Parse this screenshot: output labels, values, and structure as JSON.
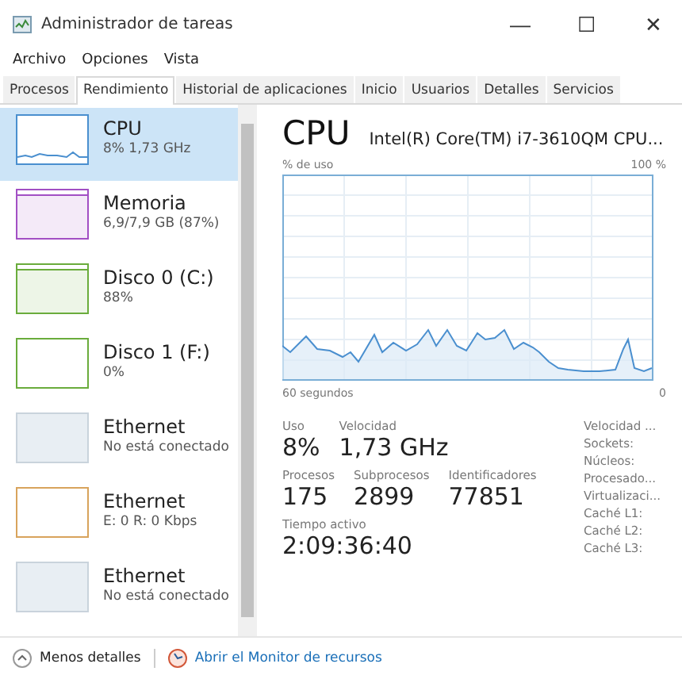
{
  "window": {
    "title": "Administrador de tareas",
    "controls": [
      "—",
      "☐",
      "✕"
    ]
  },
  "menu": [
    "Archivo",
    "Opciones",
    "Vista"
  ],
  "tabs": [
    {
      "label": "Procesos",
      "selected": false
    },
    {
      "label": "Rendimiento",
      "selected": true
    },
    {
      "label": "Historial de aplicaciones",
      "selected": false
    },
    {
      "label": "Inicio",
      "selected": false
    },
    {
      "label": "Usuarios",
      "selected": false
    },
    {
      "label": "Detalles",
      "selected": false
    },
    {
      "label": "Servicios",
      "selected": false
    }
  ],
  "sidebar": {
    "items": [
      {
        "name": "CPU",
        "detail": "8% 1,73 GHz",
        "selected": true,
        "color": "#4a8fcf",
        "kind": "line"
      },
      {
        "name": "Memoria",
        "detail": "6,9/7,9 GB (87%)",
        "selected": false,
        "color": "#a24fc4",
        "kind": "full"
      },
      {
        "name": "Disco 0 (C:)",
        "detail": "88%",
        "selected": false,
        "color": "#6aac3c",
        "kind": "full"
      },
      {
        "name": "Disco 1 (F:)",
        "detail": "0%",
        "selected": false,
        "color": "#6aac3c",
        "kind": "empty"
      },
      {
        "name": "Ethernet",
        "detail": "No está conectado",
        "selected": false,
        "color": "#c9d3dc",
        "kind": "off"
      },
      {
        "name": "Ethernet",
        "detail": "E: 0 R: 0 Kbps",
        "selected": false,
        "color": "#d8a35c",
        "kind": "empty"
      },
      {
        "name": "Ethernet",
        "detail": "No está conectado",
        "selected": false,
        "color": "#c9d3dc",
        "kind": "off"
      }
    ]
  },
  "detail": {
    "title": "CPU",
    "model": "Intel(R) Core(TM) i7-3610QM CPU...",
    "graph_label": "% de uso",
    "graph_max": "100 %",
    "graph_time": "60 segundos",
    "graph_min": "0",
    "stats": [
      {
        "label": "Uso",
        "value": "8%"
      },
      {
        "label": "Velocidad",
        "value": "1,73 GHz"
      }
    ],
    "stats2": [
      {
        "label": "Procesos",
        "value": "175"
      },
      {
        "label": "Subprocesos",
        "value": "2899"
      },
      {
        "label": "Identificadores",
        "value": "77851"
      }
    ],
    "uptime": {
      "label": "Tiempo activo",
      "value": "2:09:36:40"
    },
    "specs": [
      "Velocidad ...",
      "Sockets:",
      "Núcleos:",
      "Procesado...",
      "Virtualizaci...",
      "Caché L1:",
      "Caché L2:",
      "Caché L3:"
    ]
  },
  "footer": {
    "less": "Menos detalles",
    "monitor": "Abrir el Monitor de recursos"
  }
}
